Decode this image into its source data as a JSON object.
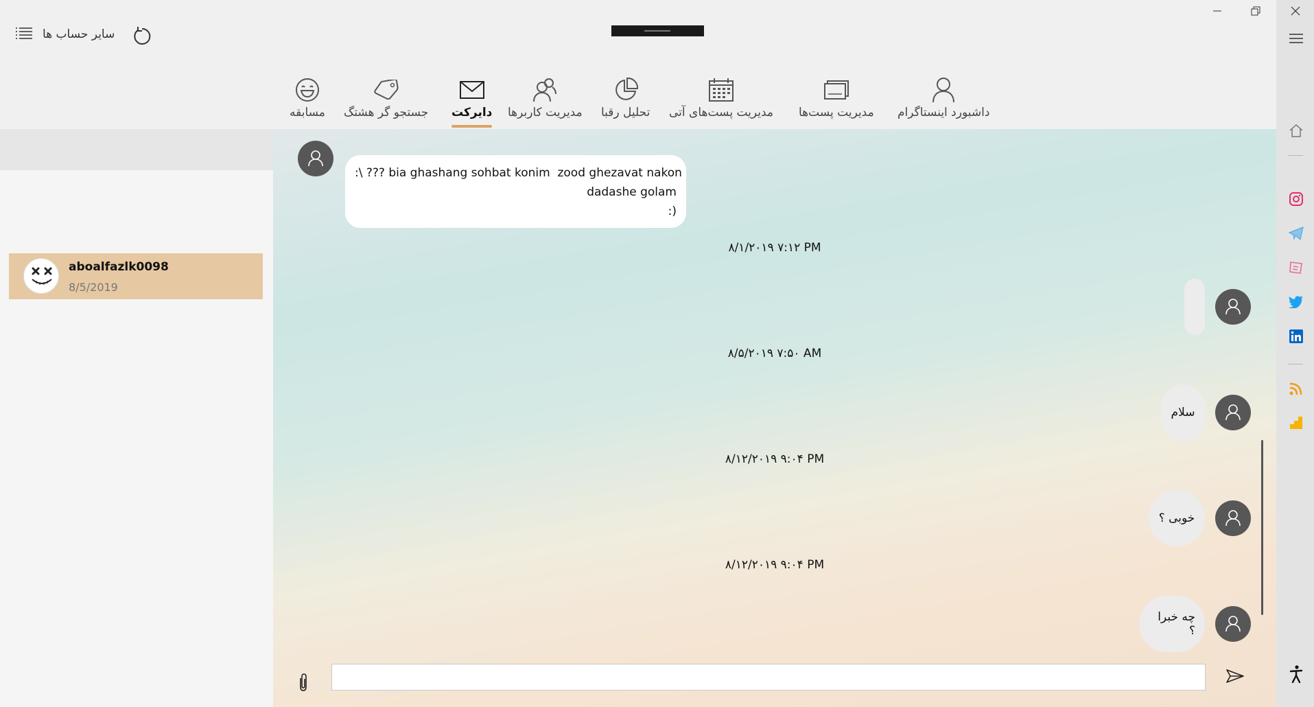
{
  "titlebar": {
    "accounts_label": "سایر حساب ها",
    "menu_icon": "list-icon",
    "refresh_icon": "refresh-icon"
  },
  "tabs": [
    {
      "label": "داشبورد اینستاگرام",
      "icon": "person-icon"
    },
    {
      "label": "مدیریت پست‌ها",
      "icon": "posts-icon"
    },
    {
      "label": "مدیریت پست‌های آتی",
      "icon": "calendar-icon"
    },
    {
      "label": "تحلیل رقبا",
      "icon": "pie-chart-icon"
    },
    {
      "label": "مدیریت کاربرها",
      "icon": "users-icon"
    },
    {
      "label": "دایرکت",
      "icon": "mail-icon",
      "active": true
    },
    {
      "label": "جستجو گر هشتگ",
      "icon": "tag-icon"
    },
    {
      "label": "مسابقه",
      "icon": "smiley-icon"
    }
  ],
  "conversations": [
    {
      "name": "aboalfazlk0098",
      "date": "8/5/2019"
    }
  ],
  "messages": {
    "first_bubble_lines": [
      ":\\ ??? bia ghashang sohbat konim  zood ghezavat nakon",
      "dadashe golam",
      ":)"
    ],
    "stamp1": "۸/۱/۲۰۱۹ ۷:۱۲ PM",
    "empty_bubble": "",
    "stamp2": "۸/۵/۲۰۱۹ ۷:۵۰ AM",
    "msg_salam": "سلام",
    "stamp3": "۸/۱۲/۲۰۱۹ ۹:۰۴ PM",
    "msg_khobi": "خوبی ؟",
    "stamp4": "۸/۱۲/۲۰۱۹ ۹:۰۴ PM",
    "msg_che_khabara": "چه خبرا ؟"
  },
  "composer": {
    "value": "",
    "placeholder": ""
  },
  "colors": {
    "active_tab": "#d9a666",
    "selected_conversation": "#e6c9a2",
    "instagram": "#e1306c",
    "telegram": "#4aa3df",
    "twitter": "#1da1f2",
    "linkedin": "#0a66c2",
    "rss": "#f39c12",
    "analytics": "#f4b400"
  }
}
